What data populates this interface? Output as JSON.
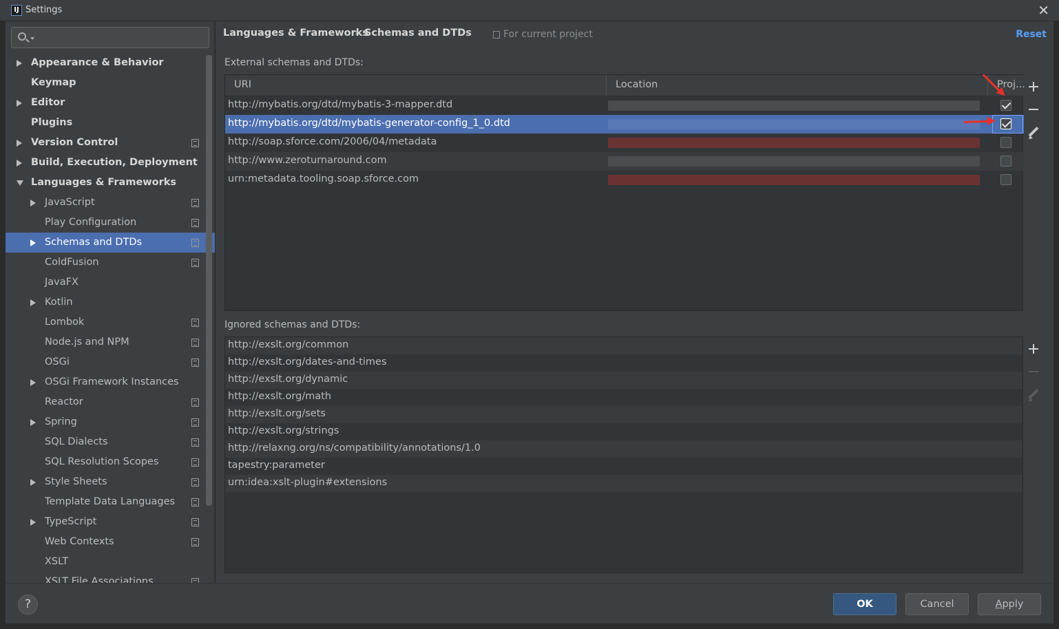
{
  "window": {
    "title": "Settings",
    "app_icon": "IJ"
  },
  "search": {
    "placeholder": ""
  },
  "nav": {
    "items": [
      {
        "label": "Appearance & Behavior",
        "bold": true,
        "arrow": "right",
        "indent": 0,
        "proj": false
      },
      {
        "label": "Keymap",
        "bold": true,
        "arrow": "none",
        "indent": 0,
        "proj": false
      },
      {
        "label": "Editor",
        "bold": true,
        "arrow": "right",
        "indent": 0,
        "proj": false
      },
      {
        "label": "Plugins",
        "bold": true,
        "arrow": "none",
        "indent": 0,
        "proj": false
      },
      {
        "label": "Version Control",
        "bold": true,
        "arrow": "right",
        "indent": 0,
        "proj": true
      },
      {
        "label": "Build, Execution, Deployment",
        "bold": true,
        "arrow": "right",
        "indent": 0,
        "proj": false
      },
      {
        "label": "Languages & Frameworks",
        "bold": true,
        "arrow": "down",
        "indent": 0,
        "proj": false
      },
      {
        "label": "JavaScript",
        "bold": false,
        "arrow": "right",
        "indent": 1,
        "proj": true
      },
      {
        "label": "Play Configuration",
        "bold": false,
        "arrow": "none",
        "indent": 1,
        "proj": true
      },
      {
        "label": "Schemas and DTDs",
        "bold": false,
        "arrow": "right",
        "indent": 1,
        "proj": true,
        "selected": true
      },
      {
        "label": "ColdFusion",
        "bold": false,
        "arrow": "none",
        "indent": 1,
        "proj": true
      },
      {
        "label": "JavaFX",
        "bold": false,
        "arrow": "none",
        "indent": 1,
        "proj": false
      },
      {
        "label": "Kotlin",
        "bold": false,
        "arrow": "right",
        "indent": 1,
        "proj": false
      },
      {
        "label": "Lombok",
        "bold": false,
        "arrow": "none",
        "indent": 1,
        "proj": true
      },
      {
        "label": "Node.js and NPM",
        "bold": false,
        "arrow": "none",
        "indent": 1,
        "proj": true
      },
      {
        "label": "OSGi",
        "bold": false,
        "arrow": "none",
        "indent": 1,
        "proj": true
      },
      {
        "label": "OSGi Framework Instances",
        "bold": false,
        "arrow": "right",
        "indent": 1,
        "proj": false
      },
      {
        "label": "Reactor",
        "bold": false,
        "arrow": "none",
        "indent": 1,
        "proj": true
      },
      {
        "label": "Spring",
        "bold": false,
        "arrow": "right",
        "indent": 1,
        "proj": true
      },
      {
        "label": "SQL Dialects",
        "bold": false,
        "arrow": "none",
        "indent": 1,
        "proj": true
      },
      {
        "label": "SQL Resolution Scopes",
        "bold": false,
        "arrow": "none",
        "indent": 1,
        "proj": true
      },
      {
        "label": "Style Sheets",
        "bold": false,
        "arrow": "right",
        "indent": 1,
        "proj": true
      },
      {
        "label": "Template Data Languages",
        "bold": false,
        "arrow": "none",
        "indent": 1,
        "proj": true
      },
      {
        "label": "TypeScript",
        "bold": false,
        "arrow": "right",
        "indent": 1,
        "proj": true
      },
      {
        "label": "Web Contexts",
        "bold": false,
        "arrow": "none",
        "indent": 1,
        "proj": true
      },
      {
        "label": "XSLT",
        "bold": false,
        "arrow": "none",
        "indent": 1,
        "proj": false
      },
      {
        "label": "XSLT File Associations",
        "bold": false,
        "arrow": "none",
        "indent": 1,
        "proj": true
      }
    ]
  },
  "breadcrumb": {
    "parent": "Languages & Frameworks",
    "sep": "›",
    "current": "Schemas and DTDs"
  },
  "scope": {
    "text": "For current project"
  },
  "reset_label": "Reset",
  "external": {
    "label": "External schemas and DTDs:",
    "columns": {
      "uri": "URI",
      "location": "Location",
      "project": "Proj..."
    },
    "rows": [
      {
        "uri": "http://mybatis.org/dtd/mybatis-3-mapper.dtd",
        "project": true,
        "loc_color": "#4a4d4f",
        "selected": false
      },
      {
        "uri": "http://mybatis.org/dtd/mybatis-generator-config_1_0.dtd",
        "project": true,
        "loc_color": "#5a78b5",
        "selected": true
      },
      {
        "uri": "http://soap.sforce.com/2006/04/metadata",
        "project": false,
        "loc_color": "#6b3234",
        "selected": false
      },
      {
        "uri": "http://www.zeroturnaround.com",
        "project": false,
        "loc_color": "#4a4d4f",
        "selected": false
      },
      {
        "uri": "urn:metadata.tooling.soap.sforce.com",
        "project": false,
        "loc_color": "#6b3234",
        "selected": false
      }
    ]
  },
  "ignored": {
    "label": "Ignored schemas and DTDs:",
    "rows": [
      "http://exslt.org/common",
      "http://exslt.org/dates-and-times",
      "http://exslt.org/dynamic",
      "http://exslt.org/math",
      "http://exslt.org/sets",
      "http://exslt.org/strings",
      "http://relaxng.org/ns/compatibility/annotations/1.0",
      "tapestry:parameter",
      "urn:idea:xslt-plugin#extensions"
    ]
  },
  "footer": {
    "help": "?",
    "ok": "OK",
    "cancel": "Cancel",
    "apply_first": "A",
    "apply_rest": "pply"
  }
}
